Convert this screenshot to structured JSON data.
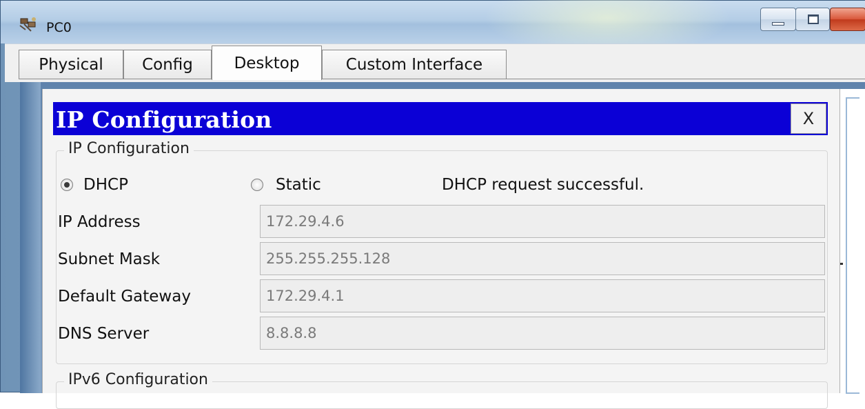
{
  "window": {
    "title": "PC0"
  },
  "tabs": [
    {
      "label": "Physical",
      "active": false
    },
    {
      "label": "Config",
      "active": false
    },
    {
      "label": "Desktop",
      "active": true
    },
    {
      "label": "Custom Interface",
      "active": false
    }
  ],
  "dialog": {
    "title": "IP Configuration",
    "close_label": "X",
    "group_label": "IP Configuration",
    "mode_options": [
      {
        "label": "DHCP",
        "selected": true
      },
      {
        "label": "Static",
        "selected": false
      }
    ],
    "status": "DHCP request successful.",
    "fields": [
      {
        "label": "IP Address",
        "value": "172.29.4.6"
      },
      {
        "label": "Subnet Mask",
        "value": "255.255.255.128"
      },
      {
        "label": "Default Gateway",
        "value": "172.29.4.1"
      },
      {
        "label": "DNS Server",
        "value": "8.8.8.8"
      }
    ],
    "ipv6_group_label": "IPv6 Configuration"
  },
  "colors": {
    "header_bg": "#0b00d6",
    "header_text": "#ffffff",
    "panel_bg": "#f4f4f4",
    "input_bg": "#eeeeee",
    "input_text": "#7a7a7a"
  },
  "icons": {
    "app": "pc-network-icon",
    "minimize": "minimize-icon",
    "maximize": "maximize-icon",
    "close": "close-icon"
  }
}
